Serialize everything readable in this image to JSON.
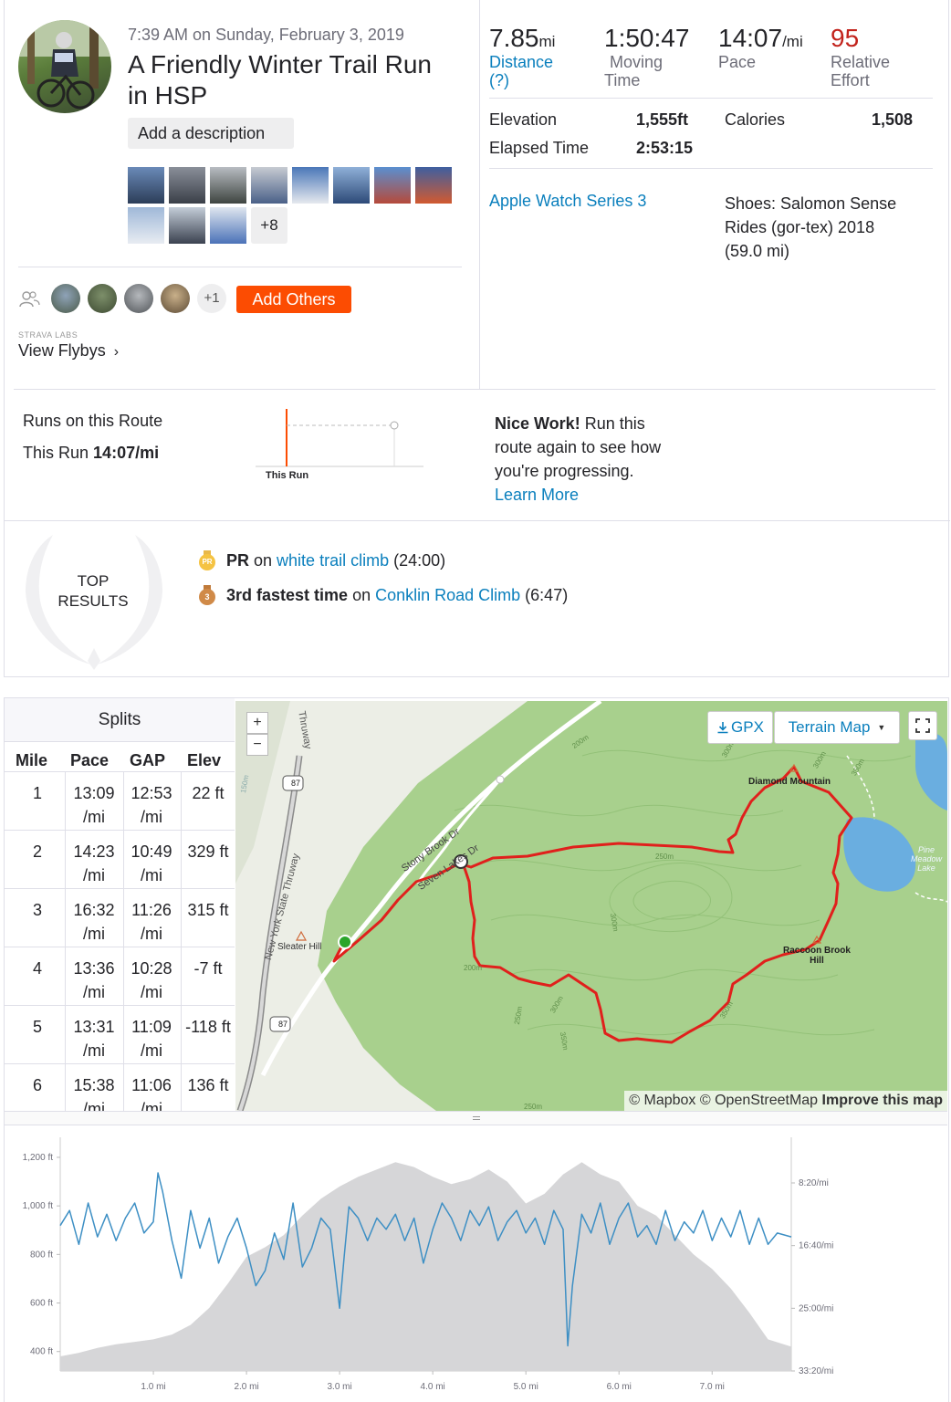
{
  "activity": {
    "datetime": "7:39 AM on Sunday, February 3, 2019",
    "title_line1": "A Friendly Winter Trail Run",
    "title_line2": "in HSP",
    "add_description": "Add a description",
    "more_photos": "+8"
  },
  "athletes": {
    "extra_count": "+1",
    "add_others": "Add Others"
  },
  "labs": {
    "heading": "STRAVA LABS",
    "view_flybys": "View Flybys",
    "chevron": "›"
  },
  "stats": {
    "distance_value": "7.85",
    "distance_unit": "mi",
    "distance_label_line1": "Distance",
    "distance_label_line2": "(?)",
    "moving_time_value": "1:50:47",
    "moving_time_label_line1": "Moving",
    "moving_time_label_line2": "Time",
    "pace_value": "14:07",
    "pace_unit": "/mi",
    "pace_label": "Pace",
    "effort_value": "95",
    "effort_label_line1": "Relative",
    "effort_label_line2": "Effort",
    "elevation_label": "Elevation",
    "elevation_value": "1,555ft",
    "calories_label": "Calories",
    "calories_value": "1,508",
    "elapsed_label": "Elapsed Time",
    "elapsed_value": "2:53:15",
    "device": "Apple Watch Series 3",
    "shoes_line1": "Shoes: Salomon Sense",
    "shoes_line2": "Rides (gor-tex) 2018",
    "shoes_line3": "(59.0 mi)"
  },
  "route": {
    "heading": "Runs on this Route",
    "this_run_label": "This Run",
    "this_run_pace": "14:07/mi",
    "chart_label": "This Run",
    "nice_work_bold": "Nice Work!",
    "nice_work_line1": " Run this",
    "nice_work_line2": "route again to see how",
    "nice_work_line3": "you're progressing.",
    "learn_more": "Learn More"
  },
  "top_results": {
    "heading_line1": "TOP",
    "heading_line2": "RESULTS",
    "pr_badge": "PR",
    "pr_bold": "PR",
    "pr_on": " on ",
    "pr_segment": "white trail climb",
    "pr_time": " (24:00)",
    "third_badge": "3",
    "third_bold": "3rd fastest time",
    "third_on": " on ",
    "third_segment": "Conklin Road Climb",
    "third_time": " (6:47)"
  },
  "splits": {
    "title": "Splits",
    "headers": [
      "Mile",
      "Pace",
      "GAP",
      "Elev"
    ],
    "unit": "/mi",
    "rows": [
      {
        "mile": "1",
        "pace": "13:09",
        "gap": "12:53",
        "elev": "22 ft"
      },
      {
        "mile": "2",
        "pace": "14:23",
        "gap": "10:49",
        "elev": "329 ft"
      },
      {
        "mile": "3",
        "pace": "16:32",
        "gap": "11:26",
        "elev": "315 ft"
      },
      {
        "mile": "4",
        "pace": "13:36",
        "gap": "10:28",
        "elev": "-7 ft"
      },
      {
        "mile": "5",
        "pace": "13:31",
        "gap": "11:09",
        "elev": "-118 ft"
      },
      {
        "mile": "6",
        "pace": "15:38",
        "gap": "11:06",
        "elev": "136 ft"
      }
    ]
  },
  "map": {
    "zoom_in": "+",
    "zoom_out": "−",
    "gpx": "GPX",
    "terrain": "Terrain Map",
    "attribution_mapbox": "© Mapbox",
    "attribution_osm": "© OpenStreetMap",
    "attribution_improve": "Improve this map",
    "labels": {
      "thruway": "Thruway",
      "nys_thruway": "New York State Thruway",
      "stony_brook": "Stony Brook Dr",
      "seven_lakes": "Seven Lakes Dr",
      "sleater_hill": "Sleater Hill",
      "diamond_mountain": "Diamond Mountain",
      "raccoon_brook_1": "Raccoon Brook",
      "raccoon_brook_2": "Hill",
      "pine_meadow_1": "Pine",
      "pine_meadow_2": "Meadow",
      "pine_meadow_3": "Lake",
      "route87a": "87",
      "route87b": "87",
      "c150": "150m",
      "c200a": "200m",
      "c200b": "200m",
      "c250a": "250m",
      "c250b": "250m",
      "c250c": "250m",
      "c300a": "300m",
      "c300b": "300m",
      "c300c": "300m",
      "c300d": "300m",
      "c350a": "350m",
      "c350b": "350m",
      "c350c": "350m"
    }
  },
  "colors": {
    "brand_orange": "#fc4c02",
    "link_blue": "#0a7fbd",
    "effort_red": "#c2231c",
    "route_red": "#e0201c",
    "forest_green": "#a8d08d",
    "pace_line": "#3d8fc4",
    "elevation_fill": "#d6d6d8"
  },
  "chart_data": {
    "type": "area",
    "xlabel": "",
    "x_ticks": [
      "1.0 mi",
      "2.0 mi",
      "3.0 mi",
      "4.0 mi",
      "5.0 mi",
      "6.0 mi",
      "7.0 mi"
    ],
    "xlim": [
      0,
      7.85
    ],
    "elevation_ticks": [
      "400 ft",
      "600 ft",
      "800 ft",
      "1,000 ft",
      "1,200 ft"
    ],
    "elevation_ylim": [
      320,
      1260
    ],
    "pace_ticks": [
      "8:20/mi",
      "16:40/mi",
      "25:00/mi",
      "33:20/mi"
    ],
    "series": [
      {
        "name": "",
        "kind": "elevation_ft",
        "x": [
          0,
          0.2,
          0.4,
          0.6,
          0.8,
          1.0,
          1.2,
          1.4,
          1.6,
          1.8,
          2.0,
          2.2,
          2.4,
          2.6,
          2.8,
          3.0,
          3.2,
          3.4,
          3.6,
          3.8,
          4.0,
          4.2,
          4.4,
          4.6,
          4.8,
          5.0,
          5.2,
          5.4,
          5.6,
          5.8,
          6.0,
          6.2,
          6.4,
          6.6,
          6.8,
          7.0,
          7.2,
          7.4,
          7.6,
          7.85
        ],
        "y": [
          380,
          395,
          415,
          430,
          440,
          450,
          470,
          510,
          580,
          680,
          790,
          830,
          880,
          960,
          1030,
          1080,
          1120,
          1150,
          1180,
          1160,
          1120,
          1090,
          1110,
          1150,
          1100,
          1010,
          1050,
          1130,
          1180,
          1130,
          1100,
          1000,
          960,
          880,
          800,
          740,
          660,
          560,
          450,
          420
        ]
      },
      {
        "name": "",
        "kind": "pace_min_per_mi",
        "x": [
          0,
          0.1,
          0.2,
          0.3,
          0.4,
          0.5,
          0.6,
          0.7,
          0.8,
          0.9,
          1.0,
          1.05,
          1.1,
          1.2,
          1.3,
          1.4,
          1.5,
          1.6,
          1.7,
          1.8,
          1.9,
          2.0,
          2.1,
          2.2,
          2.3,
          2.4,
          2.5,
          2.6,
          2.7,
          2.8,
          2.9,
          3.0,
          3.05,
          3.1,
          3.2,
          3.3,
          3.4,
          3.5,
          3.6,
          3.7,
          3.8,
          3.9,
          4.0,
          4.1,
          4.2,
          4.3,
          4.4,
          4.5,
          4.6,
          4.7,
          4.8,
          4.9,
          5.0,
          5.1,
          5.2,
          5.3,
          5.4,
          5.45,
          5.5,
          5.6,
          5.7,
          5.8,
          5.9,
          6.0,
          6.1,
          6.2,
          6.3,
          6.4,
          6.5,
          6.6,
          6.7,
          6.8,
          6.9,
          7.0,
          7.1,
          7.2,
          7.3,
          7.4,
          7.5,
          7.6,
          7.7,
          7.85
        ],
        "y": [
          14.0,
          12.0,
          16.5,
          11.0,
          15.5,
          12.5,
          16.0,
          13.0,
          11.0,
          15.0,
          13.5,
          7.0,
          9.5,
          16.0,
          21.0,
          12.0,
          17.0,
          13.0,
          19.0,
          15.5,
          13.0,
          17.0,
          22.0,
          20.0,
          15.0,
          18.5,
          11.0,
          19.5,
          17.0,
          13.0,
          14.5,
          25.0,
          18.0,
          11.5,
          13.0,
          16.0,
          13.0,
          14.5,
          12.5,
          16.0,
          13.0,
          19.0,
          14.5,
          11.0,
          13.0,
          16.0,
          12.0,
          14.0,
          11.5,
          16.0,
          13.5,
          12.0,
          15.0,
          13.0,
          16.5,
          12.0,
          14.5,
          30.0,
          22.0,
          12.5,
          15.0,
          11.0,
          16.5,
          13.0,
          11.0,
          15.5,
          14.0,
          16.5,
          12.0,
          16.0,
          13.5,
          15.0,
          12.0,
          16.0,
          13.0,
          15.5,
          12.0,
          16.5,
          13.0,
          16.5,
          15.0,
          15.5
        ]
      }
    ]
  }
}
